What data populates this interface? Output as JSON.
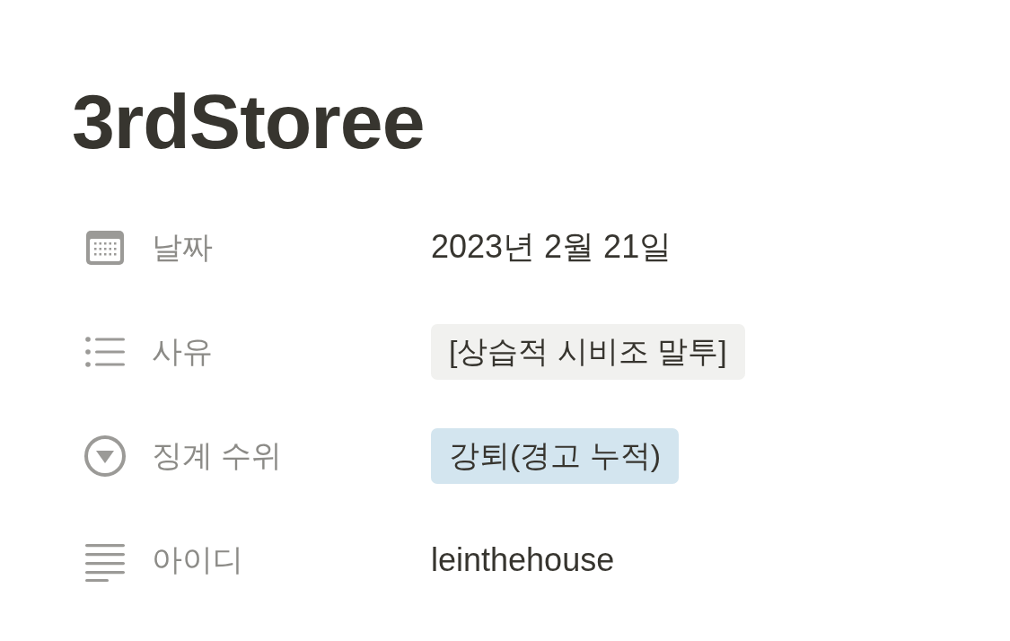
{
  "page": {
    "title": "3rdStoree"
  },
  "properties": [
    {
      "kind": "date",
      "label": "날짜",
      "value": "2023년 2월 21일"
    },
    {
      "kind": "multi_select",
      "label": "사유",
      "tags": [
        {
          "text": "[상습적 시비조 말투]",
          "color": "#f1f1ef"
        }
      ]
    },
    {
      "kind": "select",
      "label": "징계 수위",
      "tags": [
        {
          "text": "강퇴(경고 누적)",
          "color": "#d3e5ef"
        }
      ]
    },
    {
      "kind": "text",
      "label": "아이디",
      "value": "leinthehouse"
    }
  ]
}
